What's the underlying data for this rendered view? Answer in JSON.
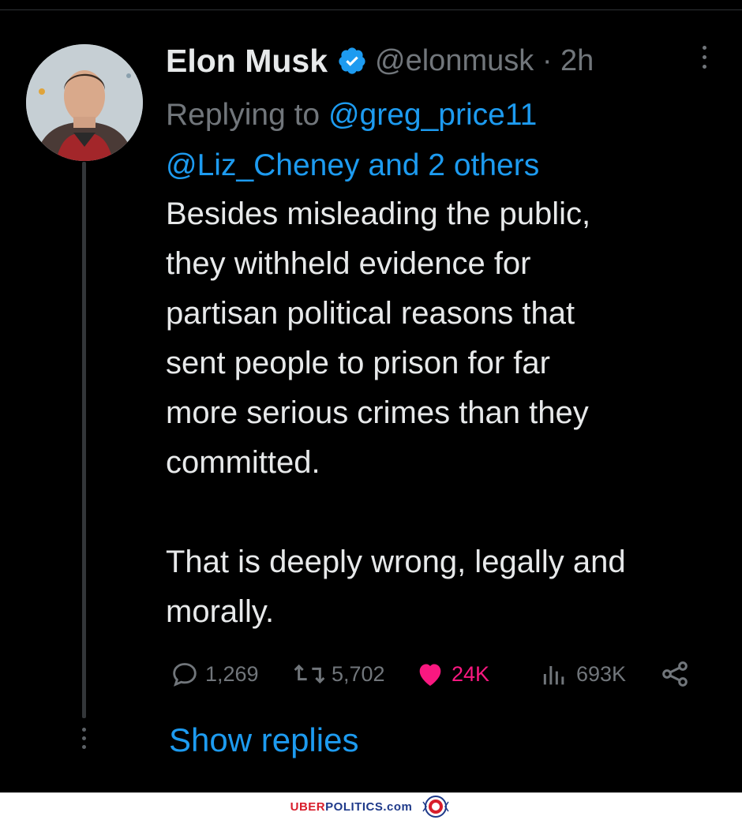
{
  "tweet": {
    "author_name": "Elon Musk",
    "handle": "@elonmusk",
    "separator": "·",
    "time_ago": "2h",
    "replying_prefix": "Replying to",
    "replying_mention_1": "@greg_price11",
    "replying_mention_2": "@Liz_Cheney and 2 others",
    "body": "Besides misleading the public,\nthey withheld evidence for\npartisan political reasons that\nsent people to prison for far\nmore serious crimes than they\ncommitted.\n\nThat is deeply wrong, legally and\nmorally."
  },
  "metrics": {
    "replies": "1,269",
    "retweets": "5,702",
    "likes": "24K",
    "views": "693K"
  },
  "thread": {
    "show_replies_label": "Show replies"
  },
  "footer": {
    "brand_part1": "UBER",
    "brand_part2": "POLITICS.com"
  },
  "icons": {
    "verified": "verified-badge-icon",
    "more": "more-options-icon",
    "reply": "reply-icon",
    "retweet": "retweet-icon",
    "like": "heart-icon",
    "views": "views-icon",
    "share": "share-icon"
  },
  "colors": {
    "background": "#000000",
    "text": "#e7e9ea",
    "muted": "#71767b",
    "link": "#1d9bf0",
    "like": "#f91880",
    "verified": "#1d9bf0"
  }
}
